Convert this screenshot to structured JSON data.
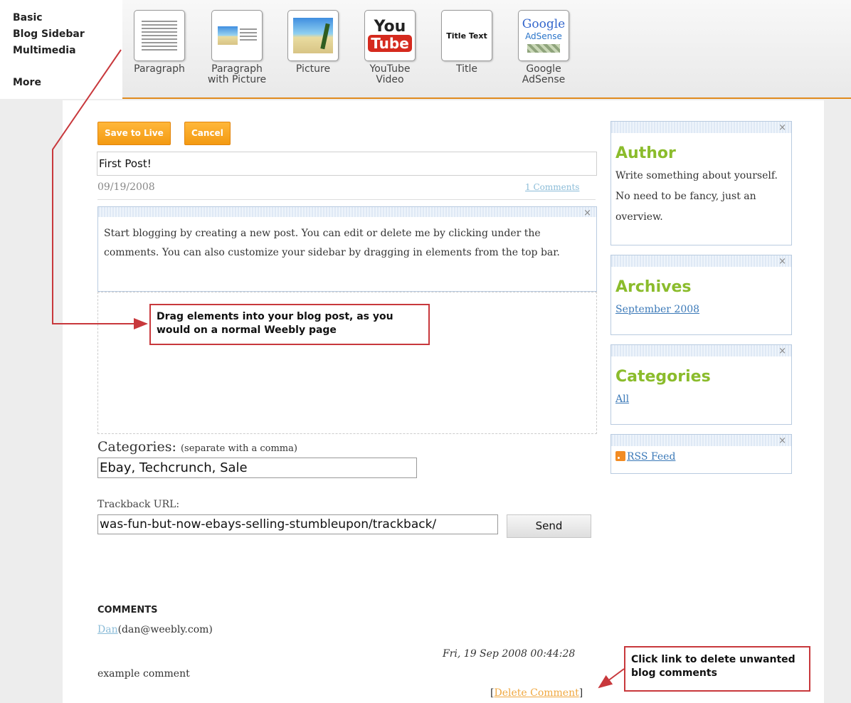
{
  "toolbar": {
    "categories": [
      "Basic",
      "Blog Sidebar",
      "Multimedia",
      "More"
    ],
    "elements": [
      {
        "label": "Paragraph",
        "icon": "paragraph-icon"
      },
      {
        "label": "Paragraph\nwith Picture",
        "icon": "paragraph-with-picture-icon"
      },
      {
        "label": "Picture",
        "icon": "picture-icon"
      },
      {
        "label": "YouTube\nVideo",
        "icon": "youtube-icon"
      },
      {
        "label": "Title",
        "icon": "title-icon"
      },
      {
        "label": "Google\nAdSense",
        "icon": "adsense-icon"
      }
    ],
    "youtube_you": "You",
    "youtube_tube": "Tube",
    "title_icon_text": "Title Text",
    "adsense_google": "Google",
    "adsense_adsense": "AdSense"
  },
  "post": {
    "save_label": "Save to Live",
    "cancel_label": "Cancel",
    "title_value": "First Post!",
    "date": "09/19/2008",
    "comments_link": "1 Comments",
    "body": "Start blogging by creating a new post. You can edit or delete me by clicking under the comments. You can also customize your sidebar by dragging in elements from the top bar.",
    "close_symbol": "×"
  },
  "callouts": {
    "drag": "Drag elements into your blog post, as you would on a normal Weebly page",
    "delete": "Click link to delete unwanted blog comments"
  },
  "categories_field": {
    "label": "Categories:",
    "hint": "(separate with a comma)",
    "value": "Ebay, Techcrunch, Sale"
  },
  "trackback": {
    "label": "Trackback URL:",
    "value": "was-fun-but-now-ebays-selling-stumbleupon/trackback/",
    "send_label": "Send"
  },
  "comments": {
    "heading": "COMMENTS",
    "author_name": "Dan",
    "author_email": "(dan@weebly.com)",
    "date": "Fri, 19 Sep 2008 00:44:28",
    "text": "example comment",
    "delete_label": "Delete Comment"
  },
  "sidebar": {
    "author_title": "Author",
    "author_text": "Write something about yourself. No need to be fancy, just an overview.",
    "archives_title": "Archives",
    "archives_link": "September 2008",
    "categories_title": "Categories",
    "categories_link": "All",
    "rss_label": "RSS Feed"
  },
  "colors": {
    "accent_orange": "#f39a12",
    "sidebar_title_green": "#8bbc2c",
    "callout_red": "#c8383c",
    "link_blue": "#3b79b8"
  }
}
